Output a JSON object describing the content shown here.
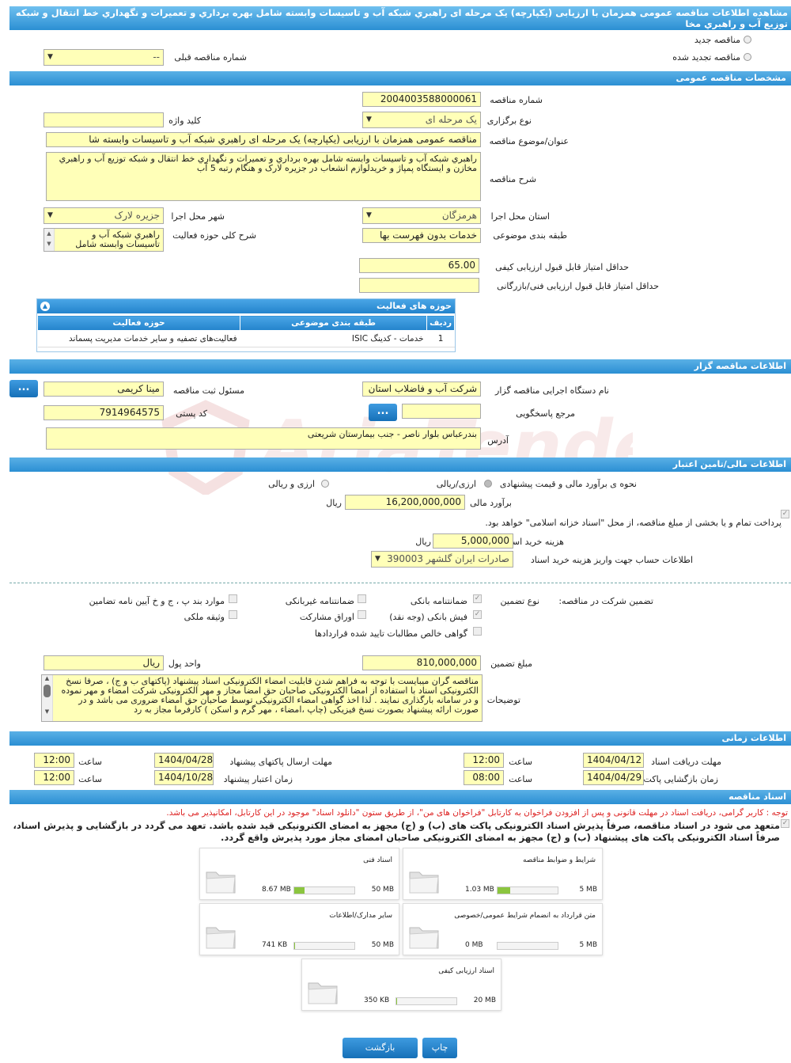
{
  "title": "مشاهده اطلاعات مناقصه عمومی همزمان با ارزیابی (یکپارچه) یک مرحله ای راهبري شبکه آب و تاسیسات وابسته شامل بهره برداري و تعميرات و نگهداري خط انتقال و شبکه توزیع آب و راهبري مخا",
  "top": {
    "new_tender": "مناقصه جدید",
    "renewed_tender": "مناقصه تجدید شده",
    "prev_number_label": "شماره مناقصه قبلی",
    "prev_number_value": "--"
  },
  "general": {
    "header": "مشخصات مناقصه عمومی",
    "number_label": "شماره مناقصه",
    "number_value": "2004003588000061",
    "type_label": "نوع برگزاری",
    "type_value": "یک مرحله ای",
    "keyword_label": "کلید واژه",
    "keyword_value": "",
    "subject_label": "عنوان/موضوع مناقصه",
    "subject_value": "مناقصه عمومی همزمان با ارزیابی (یکپارچه) یک مرحله ای راهبري شبکه آب و تاسیسات وابسته شا",
    "desc_label": "شرح مناقصه",
    "desc_value": "راهبري شبکه آب و تاسیسات وابسته شامل بهره برداري و تعميرات و نگهداري خط انتقال و شبکه توزیع آب و راهبري مخازن و ایستگاه پمپاژ و خریدلوازم انشعاب در جزیره لارک و هنگام رتبه 5 آب",
    "province_label": "استان محل اجرا",
    "province_value": "هرمزگان",
    "city_label": "شهر محل اجرا",
    "city_value": "جزیره لارک",
    "category_label": "طبقه بندی موضوعی",
    "category_value": "خدمات بدون فهرست بها",
    "scope_label": "شرح کلی حوزه فعالیت",
    "scope_value": "راهبري شبکه آب و تاسیسات وابسته شامل",
    "min_quality_label": "حداقل امتیاز قابل قبول ارزیابی کیفی",
    "min_quality_value": "65.00",
    "min_tech_label": "حداقل امتیاز قابل قبول ارزیابی فنی/بازرگانی",
    "min_tech_value": ""
  },
  "activity": {
    "header": "حوزه های فعالیت",
    "col_row": "ردیف",
    "col_category": "طبقه بندی موضوعی",
    "col_field": "حوزه فعالیت",
    "rows": [
      {
        "row": "1",
        "category": "خدمات - کدینگ ISIC",
        "field": "فعالیت‌های تصفیه و سایر خدمات مدیریت پسماند"
      }
    ]
  },
  "organizer": {
    "header": "اطلاعات مناقصه گزار",
    "org_label": "نام دستگاه اجرایی مناقصه گزار",
    "org_value": "شرکت آب و فاضلاب استان",
    "resp_label": "مسئول ثبت مناقصه",
    "resp_value": "مینا کریمی",
    "ref_label": "مرجع پاسخگویی",
    "ref_value": "",
    "postal_label": "کد پستی",
    "postal_value": "7914964575",
    "address_label": "آدرس",
    "address_value": "بندرعباس بلوار ناصر - جنب بیمارستان شریعتی",
    "dots": "..."
  },
  "finance": {
    "header": "اطلاعات مالی/تامین اعتبار",
    "method_label": "نحوه ی برآورد مالی و قیمت پیشنهادی",
    "opt_rial": "ارزی/ریالی",
    "opt_both": "ارزی و ریالی",
    "estimate_label": "برآورد مالی",
    "estimate_value": "16,200,000,000",
    "rial": "ریال",
    "payment_note": "پرداخت تمام و یا بخشی از مبلغ مناقصه، از محل \"اسناد خزانه اسلامی\" خواهد بود.",
    "doc_fee_label": "هزینه خرید اسناد",
    "doc_fee_value": "5,000,000",
    "account_label": "اطلاعات حساب جهت واریز هزینه خرید اسناد",
    "account_value": "صادرات ایران گلشهر 390003"
  },
  "guarantee": {
    "participation_label": "تضمین شرکت در مناقصه:",
    "type_label": "نوع تضمین",
    "bank_guarantee": "ضمانتنامه بانکی",
    "nonbank_guarantee": "ضمانتنامه غیربانکی",
    "items_bpjh": "موارد بند پ ، ج و خ آیین نامه تضامین",
    "bank_receipt": "فیش بانکی (وجه نقد)",
    "partnership": "اوراق مشارکت",
    "property": "وثیقه ملکی",
    "net_claims": "گواهی خالص مطالبات تایید شده قراردادها",
    "amount_label": "مبلغ تضمین",
    "amount_value": "810,000,000",
    "unit_label": "واحد پول",
    "unit_value": "ریال",
    "notes_label": "توضیحات",
    "notes_value": "مناقصه گران میبایست با توجه به فراهم شدن قابلیت امضاء الکترونیکی اسناد پیشنهاد (پاکتهای ب و ج) ، صرفا نسخ الکترونیکی اسناد با استفاده از امضا الکترونیکی صاحبان حق امضا مجاز و مهر الکترونیکی شرکت امضاء و مهر نموده و در سامانه بارگذاری نمایند . لذا اخذ گواهی امضاء الکترونیکی توسط صاحبان حق امضاء ضروری می باشد و در صورت ارائه پیشنهاد بصورت نسخ فیزیکی (چاپ ،امضاء ، مهر گرم و اسکن ) کارفرما مجاز به رد"
  },
  "timing": {
    "header": "اطلاعات زمانی",
    "doc_receive_label": "مهلت دریافت اسناد",
    "doc_receive_date": "1404/04/12",
    "doc_receive_time": "12:00",
    "send_label": "مهلت ارسال پاکتهای پیشنهاد",
    "send_date": "1404/04/28",
    "send_time": "12:00",
    "open_label": "زمان بازگشایی پاکت ها",
    "open_date": "1404/04/29",
    "open_time": "08:00",
    "valid_label": "زمان اعتبار پیشنهاد",
    "valid_date": "1404/10/28",
    "valid_time": "12:00",
    "time_label": "ساعت"
  },
  "docs": {
    "header": "اسناد مناقصه",
    "red_note": "توجه : کاربر گرامی، دریافت اسناد در مهلت قانونی و پس از افزودن فراخوان به کارتابل \"فراخوان های من\"، از طریق ستون \"دانلود اسناد\" موجود در این کارتابل، امکانپذیر می باشد.",
    "commit_note": "متعهد می شود در اسناد مناقصه، صرفاً پذیرش اسناد الکترونیکی پاکت های (ب) و (ج) مجهز به امضای الکترونیکی قید شده باشد. تعهد می گردد در بازگشایی و پذیرش اسناد، صرفاً اسناد الکترونیکی پاکت های پیشنهاد (ب) و (ج) مجهز به امضای الکترونیکی صاحبان امضای مجاز مورد پذیرش واقع گردد.",
    "files": [
      {
        "name": "شرایط و ضوابط مناقصه",
        "size": "1.03 MB",
        "max": "5 MB",
        "pct": 0.21
      },
      {
        "name": "اسناد فنی",
        "size": "8.67 MB",
        "max": "50 MB",
        "pct": 0.17
      },
      {
        "name": "متن قرارداد به انضمام شرایط عمومی/خصوصی",
        "size": "0 MB",
        "max": "5 MB",
        "pct": 0.0
      },
      {
        "name": "سایر مدارک/اطلاعات",
        "size": "741 KB",
        "max": "50 MB",
        "pct": 0.015
      },
      {
        "name": "اسناد ارزیابی کیفی",
        "size": "350 KB",
        "max": "20 MB",
        "pct": 0.017
      }
    ]
  },
  "buttons": {
    "print": "چاپ",
    "back": "بازگشت"
  },
  "watermark": "AriaTender.neT"
}
